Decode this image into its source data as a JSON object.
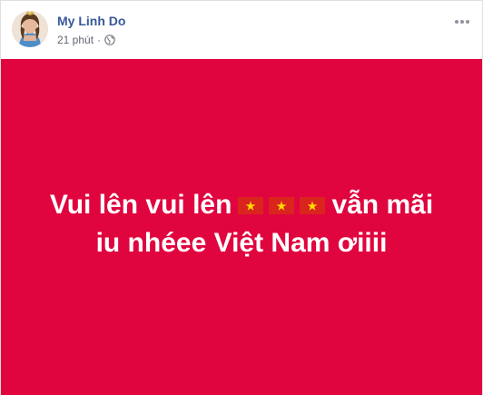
{
  "post": {
    "author": "My Linh Do",
    "time": "21 phút",
    "separator": "·",
    "privacy_icon": "globe-icon",
    "menu_icon": "more-options-icon",
    "banner_color": "#e0043f",
    "text_line1_start": "Vui lên vui lên",
    "text_line1_end": "vẫn mãi",
    "text_line2": "iu nhéee Việt Nam ơiiii",
    "emoji": [
      "vietnam-flag-icon",
      "vietnam-flag-icon",
      "vietnam-flag-icon"
    ]
  }
}
